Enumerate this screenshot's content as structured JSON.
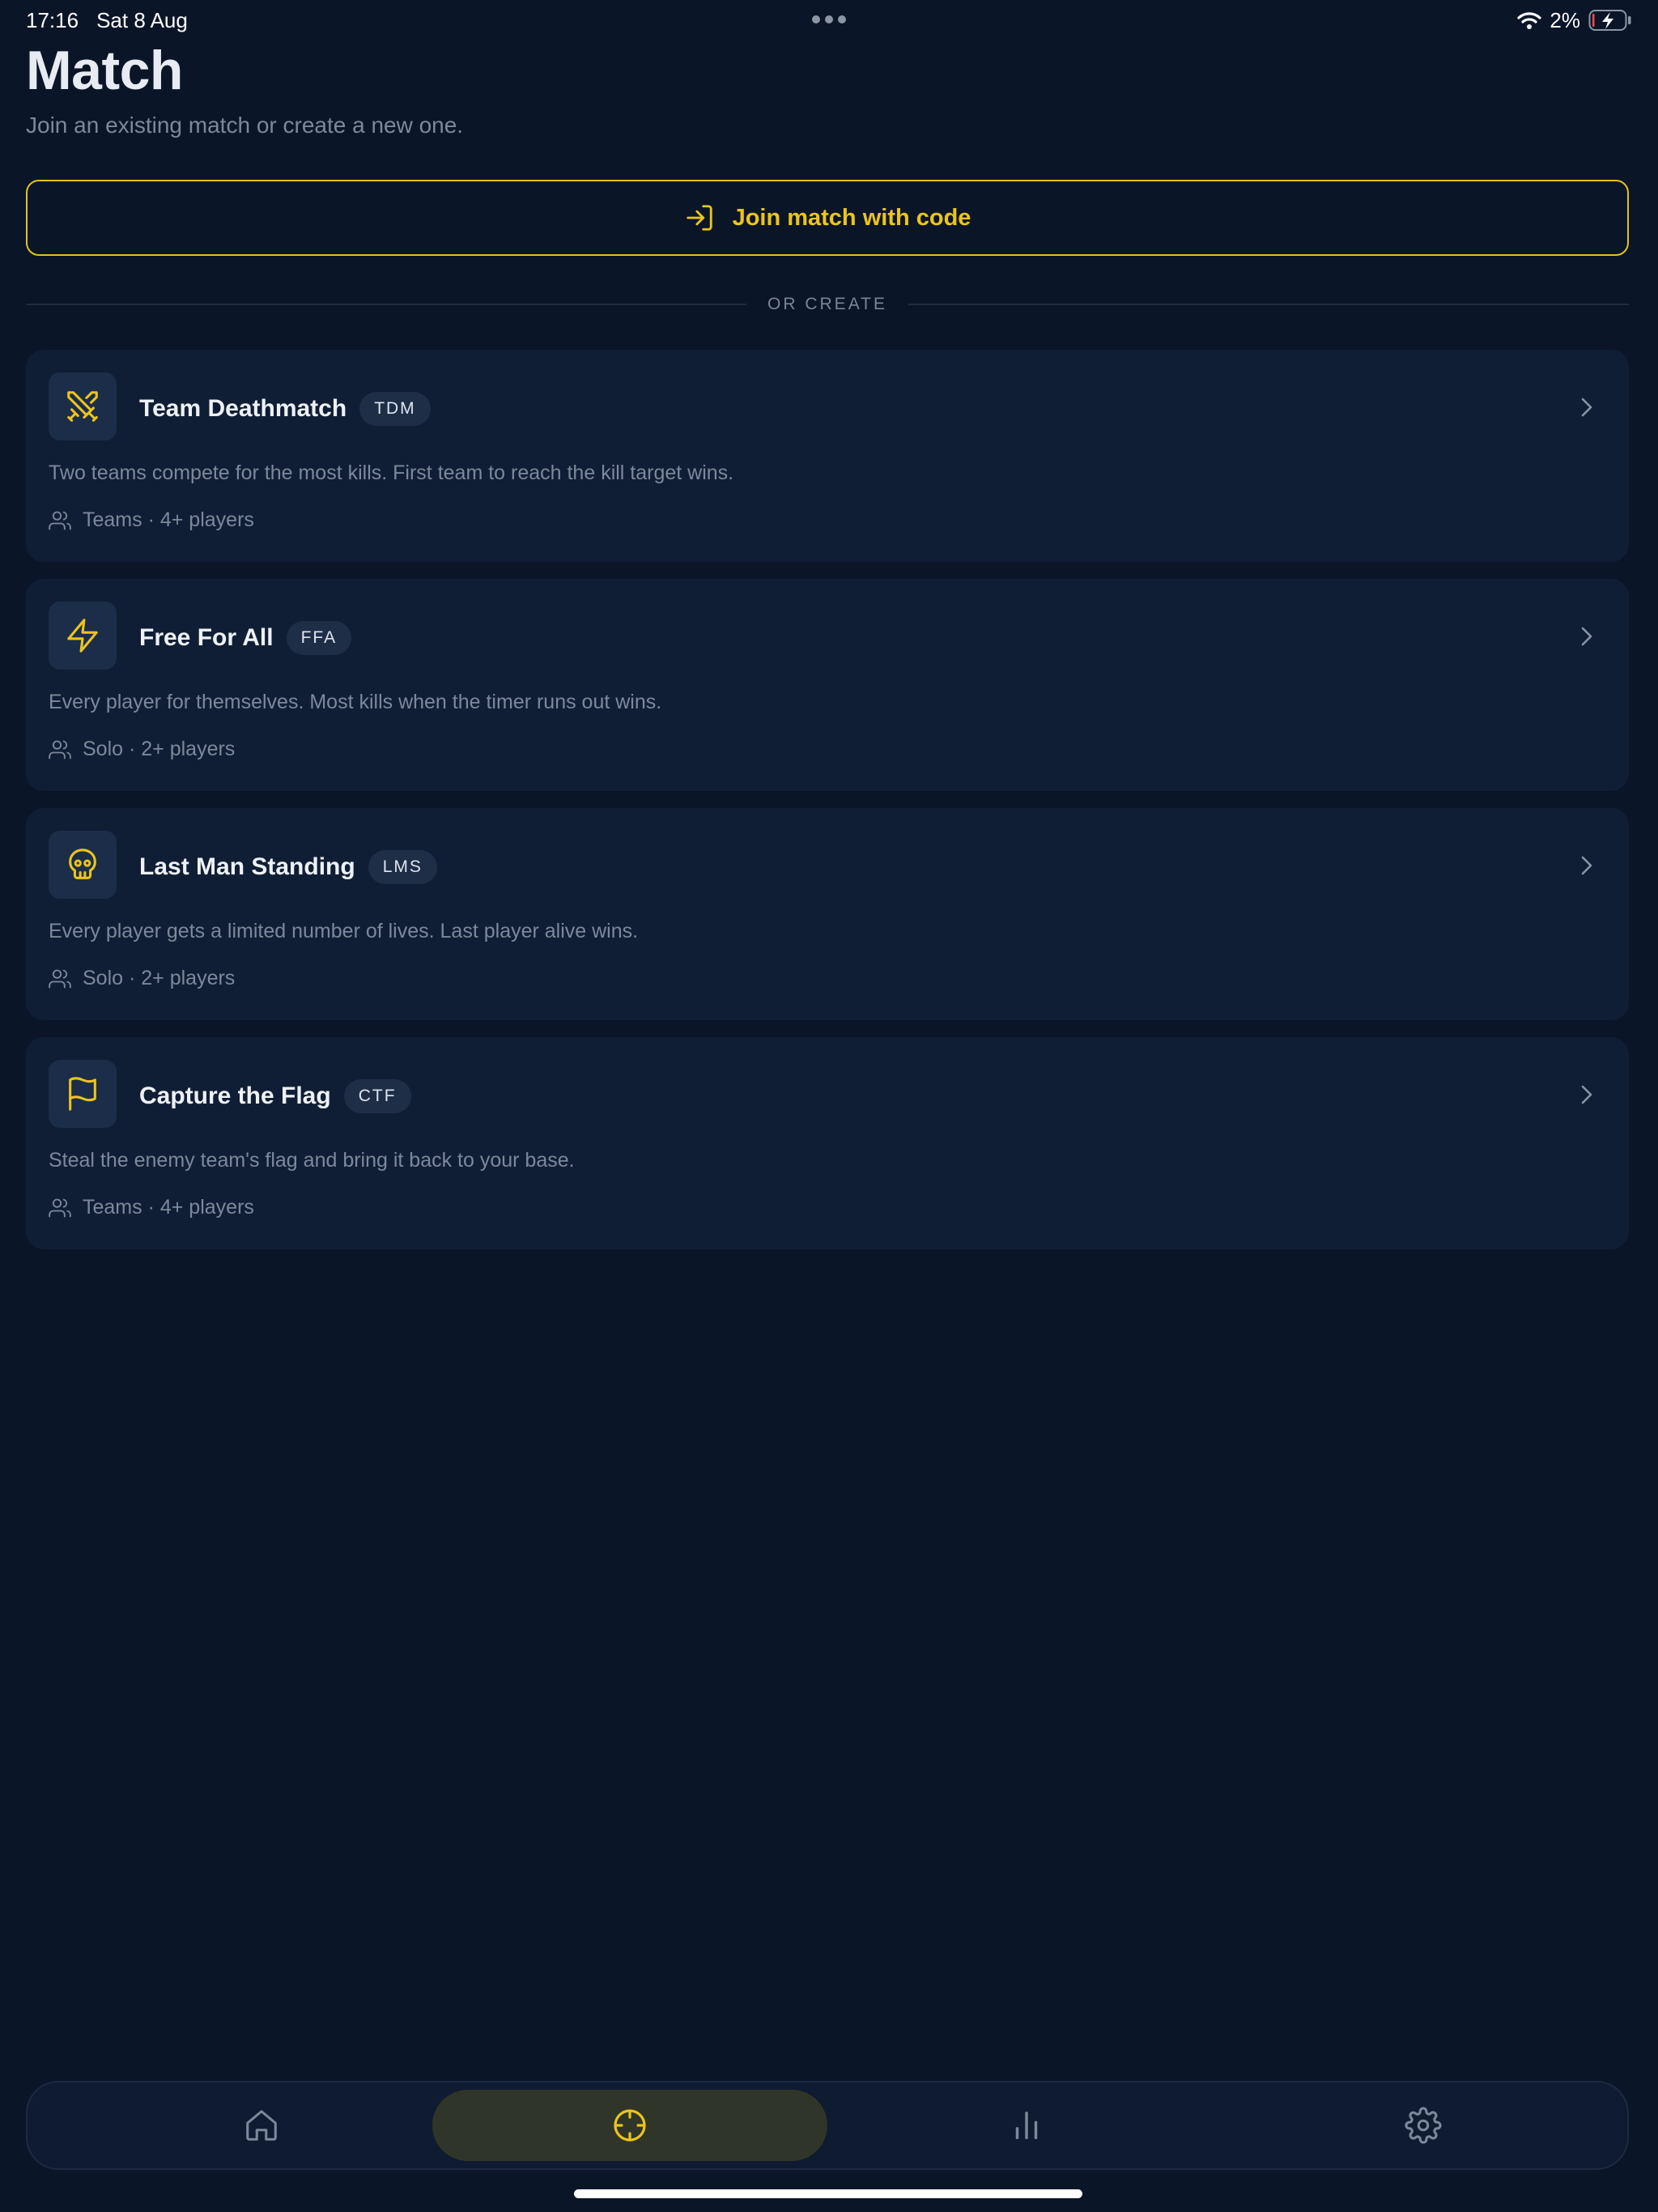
{
  "status_bar": {
    "time": "17:16",
    "date": "Sat 8 Aug",
    "battery": "2%"
  },
  "header": {
    "title": "Match",
    "subtitle": "Join an existing match or create a new one."
  },
  "join": {
    "label": "Join match with code",
    "icon": "login-icon"
  },
  "divider": {
    "label": "OR CREATE"
  },
  "modes": [
    {
      "name": "Team Deathmatch",
      "tag": "TDM",
      "icon": "crossed-swords-icon",
      "description": "Two teams compete for the most kills. First team to reach the kill target wins.",
      "meta": "Teams · 4+ players"
    },
    {
      "name": "Free For All",
      "tag": "FFA",
      "icon": "lightning-icon",
      "description": "Every player for themselves. Most kills when the timer runs out wins.",
      "meta": "Solo · 2+ players"
    },
    {
      "name": "Last Man Standing",
      "tag": "LMS",
      "icon": "skull-icon",
      "description": "Every player gets a limited number of lives. Last player alive wins.",
      "meta": "Solo · 2+ players"
    },
    {
      "name": "Capture the Flag",
      "tag": "CTF",
      "icon": "flag-icon",
      "description": "Steal the enemy team's flag and bring it back to your base.",
      "meta": "Teams · 4+ players"
    }
  ],
  "nav": {
    "items": [
      {
        "icon": "home-icon",
        "active": false
      },
      {
        "icon": "crosshair-icon",
        "active": true
      },
      {
        "icon": "bar-chart-icon",
        "active": false
      },
      {
        "icon": "gear-icon",
        "active": false
      }
    ]
  },
  "colors": {
    "background": "#0b1528",
    "card": "#101e35",
    "accent": "#ecc41c",
    "muted_text": "#7d8899",
    "active_nav": "#2f3629"
  }
}
